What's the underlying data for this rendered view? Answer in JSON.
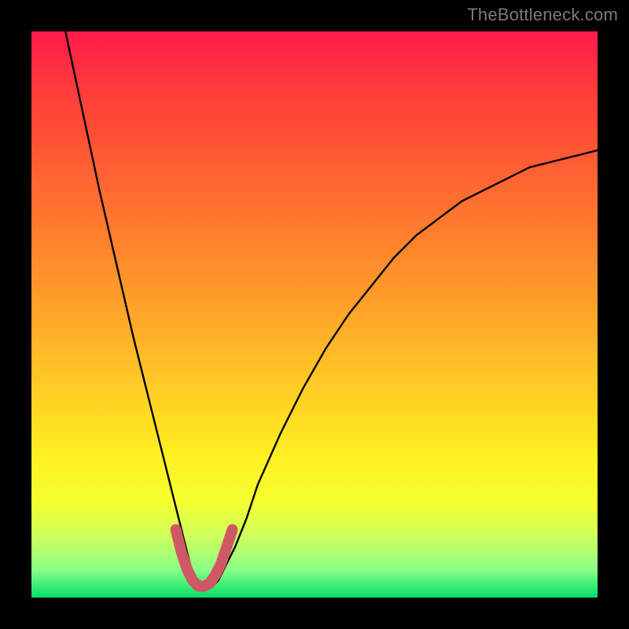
{
  "watermark": "TheBottleneck.com",
  "colors": {
    "background": "#000000",
    "curve_stroke": "#000000",
    "trough_stroke": "#cf5864",
    "gradient_top": "#ff1b4d",
    "gradient_bottom": "#02e06a"
  },
  "chart_data": {
    "type": "line",
    "title": "",
    "xlabel": "",
    "ylabel": "",
    "xlim": [
      0,
      100
    ],
    "ylim": [
      0,
      100
    ],
    "grid": false,
    "series": [
      {
        "name": "bottleneck-curve",
        "x": [
          6,
          9,
          12,
          15,
          18,
          20,
          22,
          24,
          26,
          27,
          28,
          29,
          30,
          31,
          32,
          33,
          34,
          36,
          38,
          40,
          44,
          48,
          52,
          56,
          60,
          64,
          68,
          72,
          76,
          80,
          84,
          88,
          92,
          96,
          100
        ],
        "y": [
          100,
          86,
          72,
          59,
          46,
          38,
          30,
          22,
          14,
          10,
          6,
          3,
          2,
          2,
          2,
          3,
          5,
          9,
          14,
          20,
          29,
          37,
          44,
          50,
          55,
          60,
          64,
          67,
          70,
          72,
          74,
          76,
          77,
          78,
          79
        ]
      },
      {
        "name": "trough-highlight",
        "x": [
          25.5,
          26.5,
          27.5,
          28.5,
          29.5,
          30.5,
          31.5,
          32.5,
          33.5,
          34.5,
          35.5
        ],
        "y": [
          12,
          8,
          5,
          3,
          2,
          2,
          2.5,
          4,
          6,
          9,
          12
        ]
      }
    ],
    "annotations": [
      {
        "text": "TheBottleneck.com",
        "position": "top-right"
      }
    ]
  }
}
